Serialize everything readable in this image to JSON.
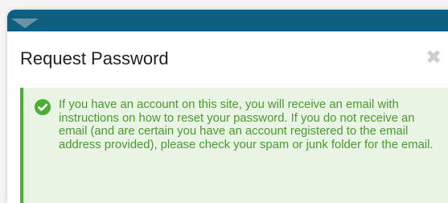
{
  "dialog": {
    "title": "Request Password",
    "close_icon": "close-icon",
    "alert": {
      "status": "success",
      "icon": "check-circle-icon",
      "message": "If you have an account on this site, you will receive an email with instructions on how to reset your password. If you do not receive an email (and are certain you have an account registered to the email address provided), please check your spam or junk folder for the email."
    }
  },
  "colors": {
    "header_bar": "#0f5f80",
    "success_accent": "#4caf34",
    "success_background": "#e9f4e4",
    "success_text": "#4a9a2e"
  }
}
